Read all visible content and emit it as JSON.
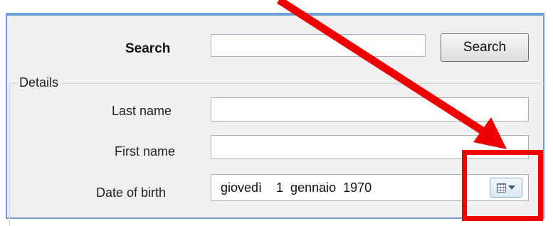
{
  "search": {
    "label": "Search",
    "value": "",
    "button_label": "Search"
  },
  "details": {
    "legend": "Details",
    "last_name": {
      "label": "Last name",
      "value": ""
    },
    "first_name": {
      "label": "First name",
      "value": ""
    },
    "date_of_birth": {
      "label": "Date of birth",
      "value": "giovedì    1  gennaio  1970",
      "picker_icon": "calendar-dropdown-icon"
    }
  },
  "annotation": {
    "color": "#ee0000",
    "target": "date-picker-dropdown-button"
  }
}
